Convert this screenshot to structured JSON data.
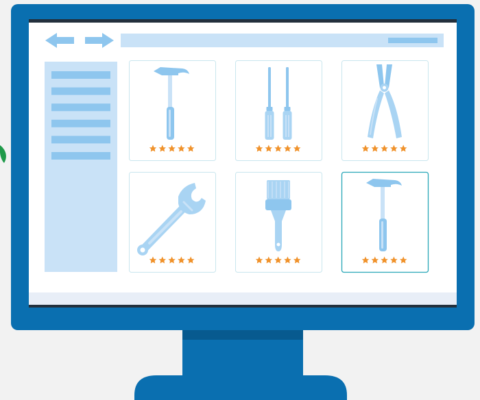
{
  "colors": {
    "background": "#f2f2f2",
    "monitor_frame": "#0a6fb0",
    "monitor_neck_shadow": "#075a8f",
    "bezel_top": "#23303d",
    "screen": "#ffffff",
    "screen_footer": "#e8eef7",
    "ui_light_blue": "#c9e2f7",
    "ui_mid_blue": "#8ec6ee",
    "ui_tool_blue": "#a9d4f3",
    "card_border": "#c9e6ee",
    "card_border_selected": "#2aa7b8",
    "star": "#f0922b",
    "leaf": "#1f9a4a"
  },
  "icons": {
    "back": "arrow-left-icon",
    "forward": "arrow-right-icon",
    "leaf": "leaf-icon"
  },
  "sidebar": {
    "item_count": 6
  },
  "products": [
    {
      "tool": "hammer",
      "icon": "hammer-icon",
      "rating": 5,
      "selected": false
    },
    {
      "tool": "screwdrivers",
      "icon": "screwdrivers-icon",
      "rating": 5,
      "selected": false
    },
    {
      "tool": "pliers",
      "icon": "pliers-icon",
      "rating": 5,
      "selected": false
    },
    {
      "tool": "adjustable-wrench",
      "icon": "wrench-icon",
      "rating": 5,
      "selected": false
    },
    {
      "tool": "paint-brush",
      "icon": "paint-brush-icon",
      "rating": 5,
      "selected": false
    },
    {
      "tool": "hammer",
      "icon": "hammer-icon",
      "rating": 5,
      "selected": true
    }
  ]
}
